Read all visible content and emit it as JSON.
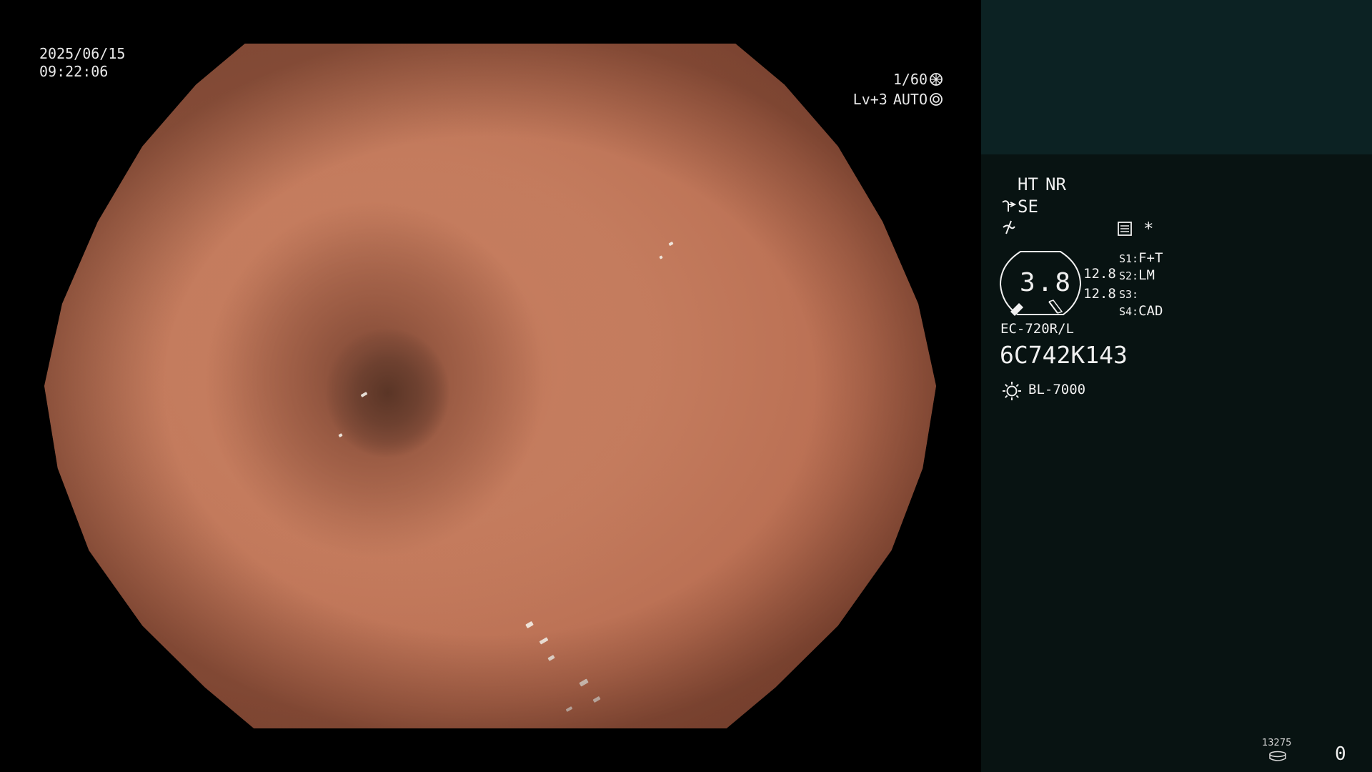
{
  "overlay": {
    "date": "2025/06/15",
    "time": "09:22:06",
    "shutter": "1/60",
    "level": "Lv+3",
    "exposure_mode": "AUTO",
    "shutter_icon": "aperture-icon",
    "auto_icon": "target-icon"
  },
  "panel": {
    "mode_ht": "HT",
    "mode_nr": "NR",
    "mode_se": "SE",
    "scope_icon": "scope-bend-icon",
    "freeze_icon": "freeze-icon",
    "memo_icon": "memo-icon",
    "asterisk": "*",
    "magnification": "3.8",
    "value_1": "12.8",
    "value_2": "12.8",
    "s1_label": "S1:",
    "s1_value": "F+T",
    "s2_label": "S2:",
    "s2_value": "LM",
    "s3_label": "S3:",
    "s3_value": "",
    "s4_label": "S4:",
    "s4_value": "CAD",
    "scope_model": "EC-720R/L",
    "serial": "6C742K143",
    "light_source": "BL-7000",
    "storage_count": "13275",
    "counter": "0"
  },
  "colors": {
    "accent_amber": "#f1a43a",
    "panel_bg": "#081312",
    "panel_top_bg": "#0c2223"
  }
}
